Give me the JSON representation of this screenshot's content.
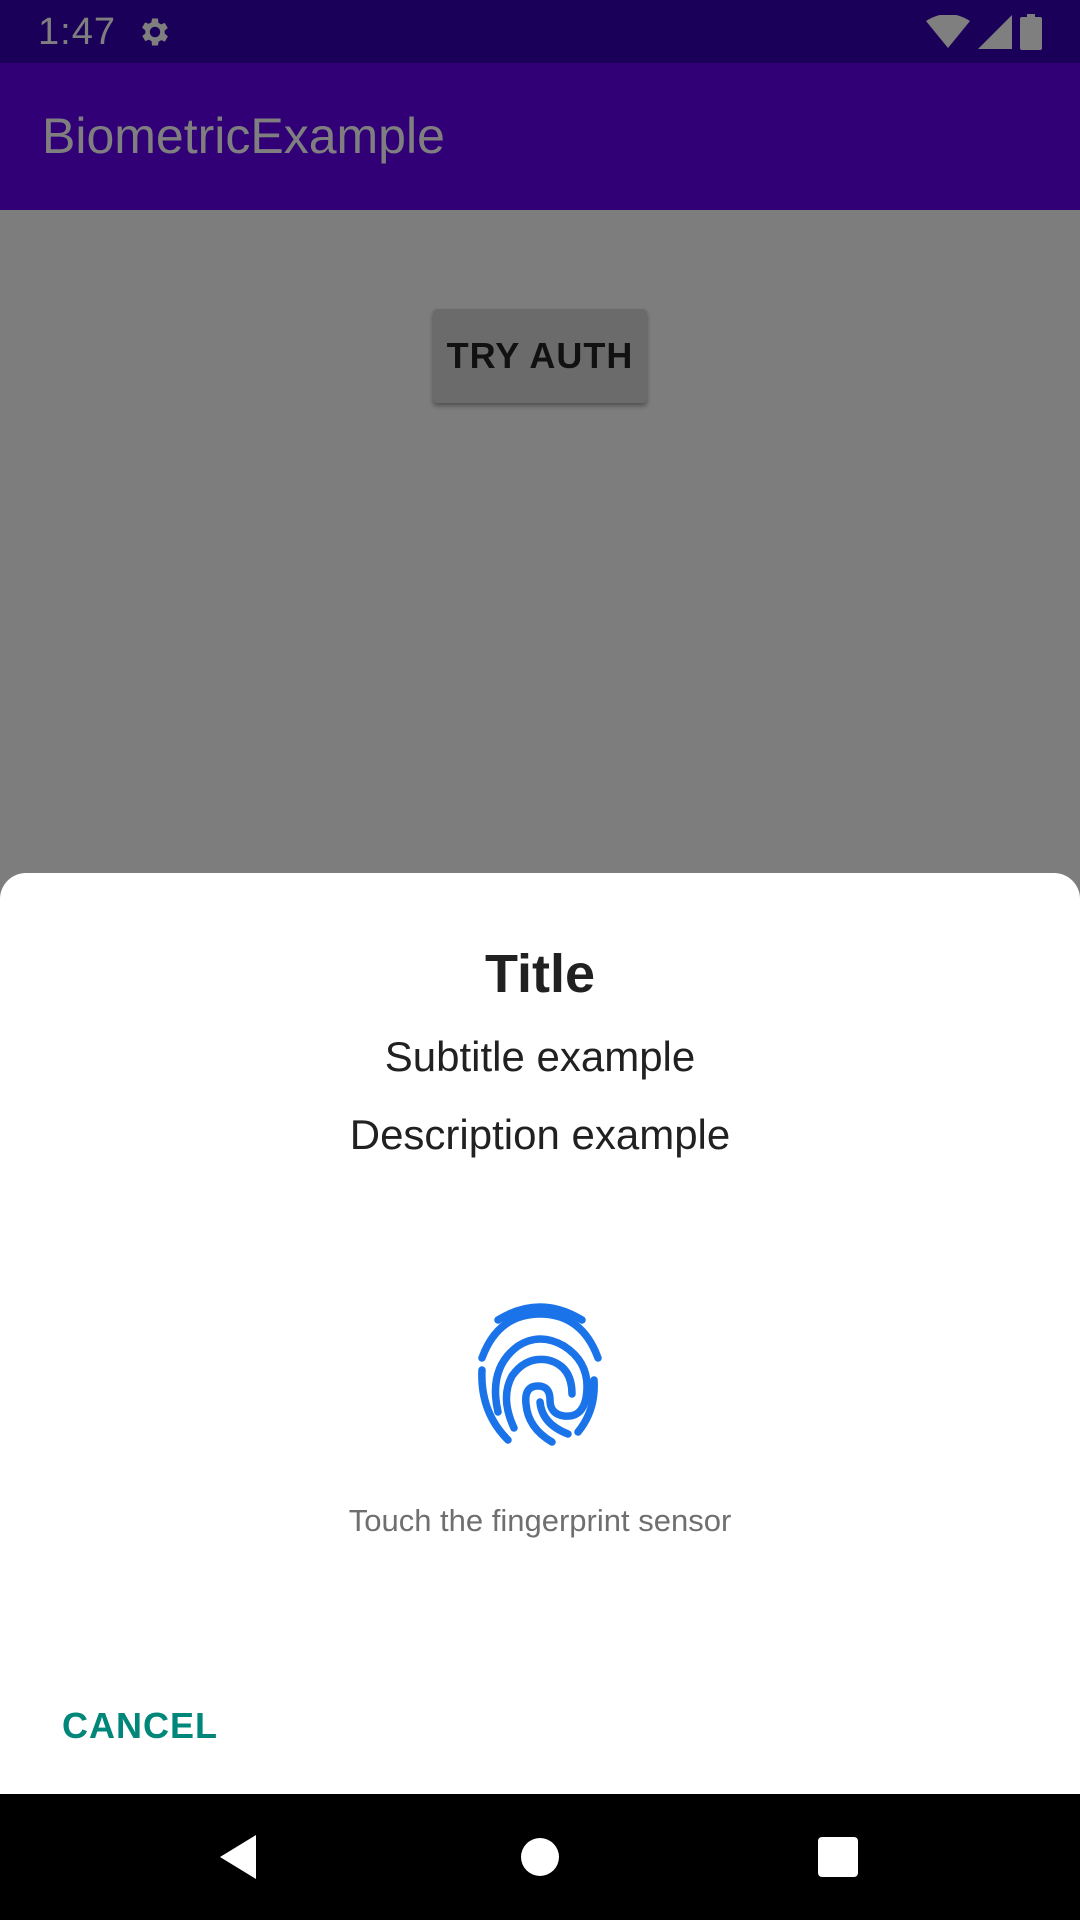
{
  "status_bar": {
    "time": "1:47",
    "icons": [
      "gear-icon",
      "wifi-icon",
      "cell-signal-icon",
      "battery-icon"
    ]
  },
  "app_bar": {
    "title": "BiometricExample"
  },
  "main": {
    "try_auth_label": "TRY AUTH"
  },
  "biometric_prompt": {
    "title": "Title",
    "subtitle": "Subtitle example",
    "description": "Description example",
    "icon": "fingerprint-icon",
    "hint": "Touch the fingerprint sensor",
    "cancel_label": "CANCEL"
  },
  "nav_bar": {
    "buttons": [
      "back-icon",
      "home-icon",
      "recents-icon"
    ]
  },
  "colors": {
    "status_bar": "#3700b3",
    "app_bar": "#6200ee",
    "fingerprint": "#1a73e8",
    "cancel": "#01877a"
  }
}
